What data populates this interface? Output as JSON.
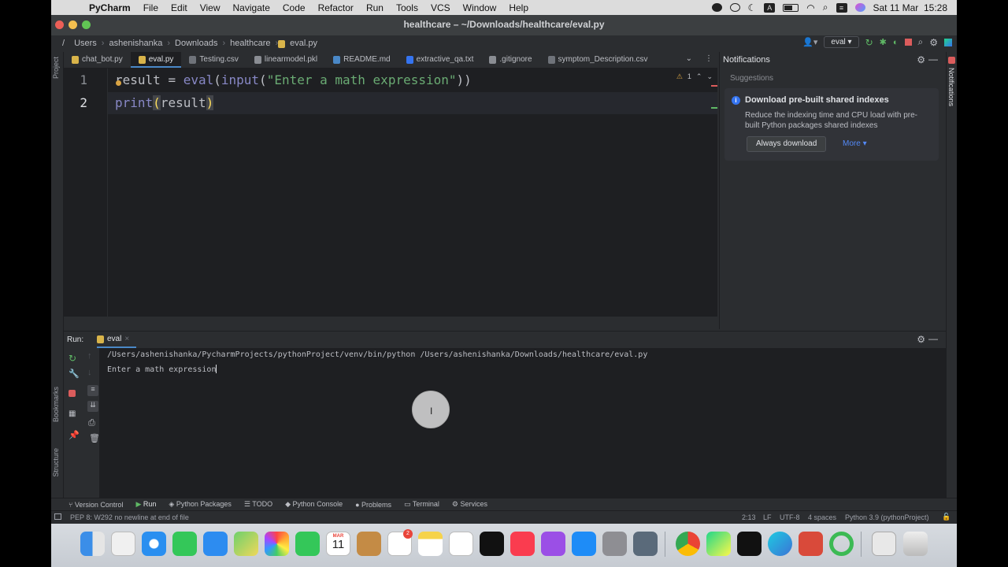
{
  "menubar": {
    "app": "PyCharm",
    "items": [
      "File",
      "Edit",
      "View",
      "Navigate",
      "Code",
      "Refactor",
      "Run",
      "Tools",
      "VCS",
      "Window",
      "Help"
    ],
    "clock": "Sat 11 Mar  15:28",
    "keyboard": "A"
  },
  "titlebar": {
    "title": "healthcare – ~/Downloads/healthcare/eval.py"
  },
  "breadcrumb": [
    "/",
    "Users",
    "ashenishanka",
    "Downloads",
    "healthcare",
    "eval.py"
  ],
  "run_config": "eval",
  "tabs": [
    {
      "label": "chat_bot.py",
      "icon": "python-file-icon"
    },
    {
      "label": "eval.py",
      "icon": "python-file-icon",
      "active": true
    },
    {
      "label": "Testing.csv",
      "icon": "csv-file-icon"
    },
    {
      "label": "linearmodel.pkl",
      "icon": "pkl-file-icon"
    },
    {
      "label": "README.md",
      "icon": "markdown-file-icon"
    },
    {
      "label": "extractive_qa.txt",
      "icon": "text-file-icon"
    },
    {
      "label": ".gitignore",
      "icon": "gitignore-file-icon"
    },
    {
      "label": "symptom_Description.csv",
      "icon": "csv-file-icon"
    }
  ],
  "editor": {
    "lines": [
      {
        "num": "1",
        "text": "result = eval(input(\"Enter a math expression\"))"
      },
      {
        "num": "2",
        "text": "print(result)"
      }
    ],
    "warnings": "1"
  },
  "notifications": {
    "title": "Notifications",
    "section": "Suggestions",
    "card_title": "Download pre-built shared indexes",
    "card_text": "Reduce the indexing time and CPU load with pre-built Python packages shared indexes",
    "button": "Always download",
    "more": "More"
  },
  "left_strip": [
    "Project",
    "Bookmarks",
    "Structure"
  ],
  "right_strip": [
    "Notifications"
  ],
  "run": {
    "label": "Run:",
    "tab": "eval",
    "console": [
      "/Users/ashenishanka/PycharmProjects/pythonProject/venv/bin/python /Users/ashenishanka/Downloads/healthcare/eval.py",
      "Enter a math expression"
    ]
  },
  "bottom_tools": [
    "Version Control",
    "Run",
    "Python Packages",
    "TODO",
    "Python Console",
    "Problems",
    "Terminal",
    "Services"
  ],
  "status": {
    "message": "PEP 8: W292 no newline at end of file",
    "position": "2:13",
    "line_sep": "LF",
    "encoding": "UTF-8",
    "indent": "4 spaces",
    "interpreter": "Python 3.9 (pythonProject)"
  },
  "dock": {
    "calendar_month": "MAR",
    "calendar_day": "11",
    "badge": "2"
  },
  "colors": {
    "accent": "#3574f0",
    "keyword": "#56a8f5",
    "string": "#6aab73",
    "stop": "#db5c5c",
    "run": "#5fb865"
  }
}
